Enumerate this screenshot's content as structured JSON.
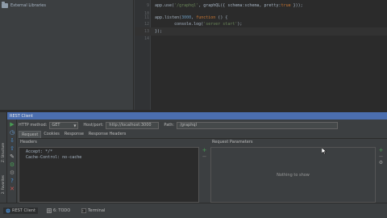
{
  "project": {
    "label": "External Libraries"
  },
  "editor": {
    "lines": [
      {
        "num": "9",
        "code": "app.use('/graphql', graphQL({ schema:schema, pretty:true }));"
      },
      {
        "num": "10",
        "code": ""
      },
      {
        "num": "11",
        "code": "app.listen(3000, function () {"
      },
      {
        "num": "12",
        "code": "        console.log('server start');"
      },
      {
        "num": "13",
        "code": "});"
      },
      {
        "num": "14",
        "code": ""
      }
    ]
  },
  "rest_client": {
    "title": "REST Client",
    "method_label": "HTTP method:",
    "method_value": "GET",
    "host_label": "Host/port:",
    "host_value": "http://localhost:3000",
    "path_label": "Path:",
    "path_value": "/graphql",
    "tabs": [
      "Request",
      "Cookies",
      "Response",
      "Response Headers"
    ],
    "headers_title": "Headers",
    "headers": [
      "Accept: */*",
      "Cache-Control: no-cache"
    ],
    "params_title": "Request Parameters",
    "params_empty": "Nothing to show"
  },
  "stripes": {
    "structure": "Z: Structure",
    "favorites": "2: Favorites"
  },
  "status_bar": {
    "items": [
      "REST Client",
      "6: TODO",
      "Terminal"
    ]
  },
  "colors": {
    "accent": "#4b6eaf",
    "run": "#499c54",
    "stop": "#c75450"
  }
}
